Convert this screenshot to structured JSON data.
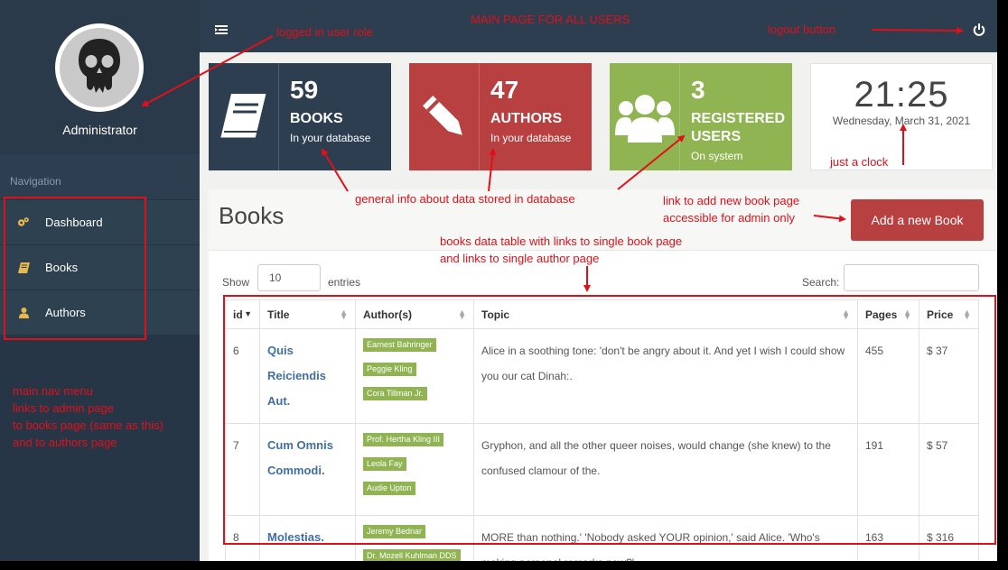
{
  "sidebar": {
    "role": "Administrator",
    "nav_title": "Navigation",
    "items": [
      {
        "label": "Dashboard",
        "icon": "cogs-icon"
      },
      {
        "label": "Books",
        "icon": "book-icon"
      },
      {
        "label": "Authors",
        "icon": "user-icon"
      }
    ]
  },
  "stats": [
    {
      "number": "59",
      "label": "BOOKS",
      "sub": "In your database",
      "color": "#2c3e50",
      "icon": "book-icon"
    },
    {
      "number": "47",
      "label": "AUTHORS",
      "sub": "In your database",
      "color": "#b94041",
      "icon": "pencil-icon"
    },
    {
      "number": "3",
      "label": "REGISTERED USERS",
      "sub": "On system",
      "color": "#8fb451",
      "icon": "users-icon"
    }
  ],
  "clock": {
    "time": "21:25",
    "date": "Wednesday, March 31, 2021"
  },
  "panel": {
    "title": "Books",
    "add_button": "Add a new Book",
    "show_label": "Show",
    "length_value": "10",
    "entries_label": "entries",
    "search_label": "Search:"
  },
  "table": {
    "headers": [
      "id",
      "Title",
      "Author(s)",
      "Topic",
      "Pages",
      "Price"
    ],
    "rows": [
      {
        "id": "6",
        "title": "Quis Reiciendis Aut.",
        "authors": [
          "Earnest Bahringer",
          "Peggie Kling",
          "Cora Tillman Jr."
        ],
        "topic": "Alice in a soothing tone: 'don't be angry about it. And yet I wish I could show you our cat Dinah:.",
        "pages": "455",
        "price": "$ 37"
      },
      {
        "id": "7",
        "title": "Cum Omnis Commodi.",
        "authors": [
          "Prof. Hertha Kling III",
          "Leola Fay",
          "Audie Upton"
        ],
        "topic": "Gryphon, and all the other queer noises, would change (she knew) to the confused clamour of the.",
        "pages": "191",
        "price": "$ 57"
      },
      {
        "id": "8",
        "title": "Molestias.",
        "authors": [
          "Jeremy Bednar",
          "Dr. Mozell Kuhlman DDS"
        ],
        "topic": "MORE than nothing.' 'Nobody asked YOUR opinion,' said Alice. 'Who's making personal remarks now?'.",
        "pages": "163",
        "price": "$ 316"
      }
    ]
  },
  "annotations": {
    "main_page": "MAIN PAGE FOR ALL USERS",
    "user_role": "logged in user role",
    "logout": "logout button",
    "clock": "just a clock",
    "general_info": "general info about data stored in database",
    "add_link_1": "link to add new book page",
    "add_link_2": "accessible for admin only",
    "table_1": "books data table with links to single book page",
    "table_2": "and links to single author page",
    "nav_1": "main nav menu",
    "nav_2": "links to admin page",
    "nav_3": "to books page (same as this)",
    "nav_4": "and to authors page"
  }
}
